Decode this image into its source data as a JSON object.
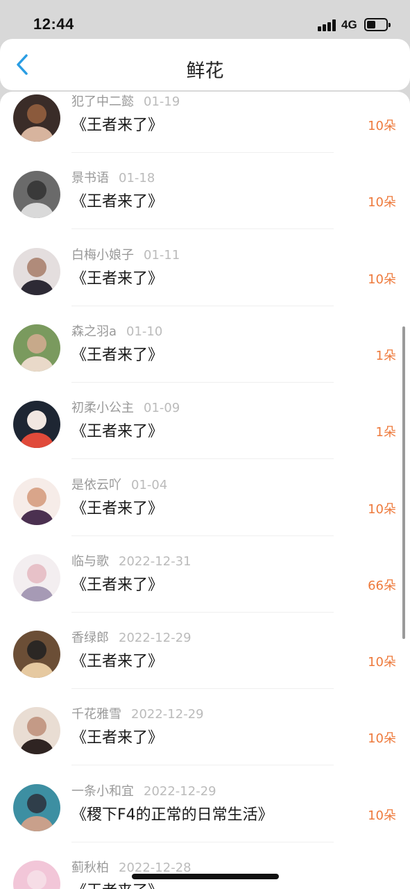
{
  "status_bar": {
    "time": "12:44",
    "network": "4G"
  },
  "header": {
    "title": "鲜花"
  },
  "list": [
    {
      "name": "犯了中二懿",
      "date": "01-19",
      "title": "《王者来了》",
      "count": "10朵",
      "avatar_colors": [
        "#3a2c28",
        "#d7b49e",
        "#8b5a3c"
      ]
    },
    {
      "name": "景书语",
      "date": "01-18",
      "title": "《王者来了》",
      "count": "10朵",
      "avatar_colors": [
        "#6a6a6a",
        "#d9d9d9",
        "#3a3a3a"
      ]
    },
    {
      "name": "白梅小娘子",
      "date": "01-11",
      "title": "《王者来了》",
      "count": "10朵",
      "avatar_colors": [
        "#e4dede",
        "#2d2a35",
        "#b08b7a"
      ]
    },
    {
      "name": "森之羽a",
      "date": "01-10",
      "title": "《王者来了》",
      "count": "1朵",
      "avatar_colors": [
        "#7a9a5e",
        "#e9d9c9",
        "#c7a98a"
      ]
    },
    {
      "name": "初柔小公主",
      "date": "01-09",
      "title": "《王者来了》",
      "count": "1朵",
      "avatar_colors": [
        "#1e2633",
        "#e04a3a",
        "#f1e7e1"
      ]
    },
    {
      "name": "是依云吖",
      "date": "01-04",
      "title": "《王者来了》",
      "count": "10朵",
      "avatar_colors": [
        "#f6ece8",
        "#4b3050",
        "#d9a58a"
      ]
    },
    {
      "name": "临与歌",
      "date": "2022-12-31",
      "title": "《王者来了》",
      "count": "66朵",
      "avatar_colors": [
        "#f3eef0",
        "#a69ab5",
        "#e7c1c8"
      ]
    },
    {
      "name": "香绿郎",
      "date": "2022-12-29",
      "title": "《王者来了》",
      "count": "10朵",
      "avatar_colors": [
        "#6b4e36",
        "#e6c9a0",
        "#2b2724"
      ]
    },
    {
      "name": "千花雅雪",
      "date": "2022-12-29",
      "title": "《王者来了》",
      "count": "10朵",
      "avatar_colors": [
        "#e9ddd3",
        "#2f2422",
        "#c49a86"
      ]
    },
    {
      "name": "一条小和宜",
      "date": "2022-12-29",
      "title": "《稷下F4的正常的日常生活》",
      "count": "10朵",
      "avatar_colors": [
        "#3d8fa2",
        "#c9a08b",
        "#2f3e4a"
      ]
    },
    {
      "name": "蓟秋柏",
      "date": "2022-12-28",
      "title": "《王者来了》",
      "count": "",
      "avatar_colors": [
        "#f2c6d8",
        "#222222",
        "#f6dde6"
      ]
    }
  ]
}
